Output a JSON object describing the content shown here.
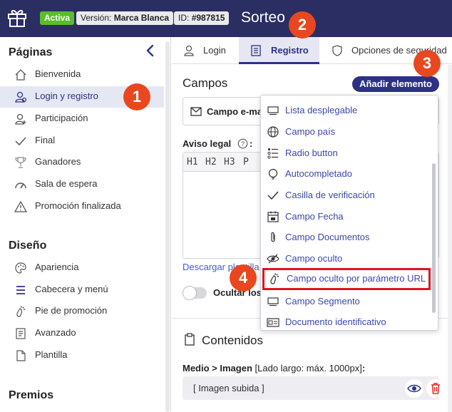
{
  "header": {
    "status_badge": "Activa",
    "version_label": "Versión:",
    "version_value": "Marca Blanca",
    "id_label": "ID:",
    "id_value": "#987815",
    "title": "Sorteo"
  },
  "markers": [
    "1",
    "2",
    "3",
    "4"
  ],
  "sidebar": {
    "sections": [
      {
        "title": "Páginas",
        "items": [
          {
            "label": "Bienvenida",
            "icon": "home-icon"
          },
          {
            "label": "Login y registro",
            "icon": "user-icon",
            "active": true
          },
          {
            "label": "Participación",
            "icon": "user-plus-icon"
          },
          {
            "label": "Final",
            "icon": "check-icon"
          },
          {
            "label": "Ganadores",
            "icon": "trophy-icon"
          },
          {
            "label": "Sala de espera",
            "icon": "speedometer-icon"
          },
          {
            "label": "Promoción finalizada",
            "icon": "warning-icon"
          }
        ]
      },
      {
        "title": "Diseño",
        "items": [
          {
            "label": "Apariencia",
            "icon": "palette-icon"
          },
          {
            "label": "Cabecera y menú",
            "icon": "menu-icon"
          },
          {
            "label": "Pie de promoción",
            "icon": "footprint-icon"
          },
          {
            "label": "Avanzado",
            "icon": "code-icon"
          },
          {
            "label": "Plantilla",
            "icon": "file-icon"
          }
        ]
      },
      {
        "title": "Premios",
        "items": []
      }
    ]
  },
  "tabs": [
    {
      "label": "Login",
      "icon": "user-icon"
    },
    {
      "label": "Registro",
      "icon": "form-icon",
      "active": true
    },
    {
      "label": "Opciones de seguridad",
      "icon": "shield-icon"
    }
  ],
  "main": {
    "campos_title": "Campos",
    "add_button": "Añadir elemento",
    "field_card_label": "Campo e-mail",
    "legal_label": "Aviso legal",
    "legal_colon": ":",
    "editor_toolbar": [
      "H1",
      "H2",
      "H3",
      "P"
    ],
    "download_link": "Descargar plantilla",
    "toggle_label": "Ocultar los",
    "contents_title": "Contenidos",
    "media_label": "Medio > Imagen",
    "media_hint": "[Lado largo: máx. 1000px]",
    "media_colon": ":",
    "image_value": "[ Imagen subida ]"
  },
  "dropdown": {
    "items": [
      {
        "label": "Lista desplegable",
        "icon": "list-icon"
      },
      {
        "label": "Campo país",
        "icon": "globe-icon"
      },
      {
        "label": "Radio button",
        "icon": "radio-list-icon"
      },
      {
        "label": "Autocompletado",
        "icon": "lightbulb-icon"
      },
      {
        "label": "Casilla de verificación",
        "icon": "check-icon"
      },
      {
        "label": "Campo Fecha",
        "icon": "calendar-icon"
      },
      {
        "label": "Campo Documentos",
        "icon": "paperclip-icon"
      },
      {
        "label": "Campo oculto",
        "icon": "eye-off-icon"
      },
      {
        "label": "Campo oculto por parámetro URL",
        "icon": "footprint-icon",
        "highlight": true
      },
      {
        "label": "Campo Segmento",
        "icon": "segment-icon"
      },
      {
        "label": "Documento identificativo",
        "icon": "id-card-icon"
      }
    ]
  },
  "colors": {
    "header_bg": "#2b2e63",
    "accent": "#2d3185",
    "active_badge": "#5bbd2b",
    "marker": "#e8471f",
    "highlight_border": "#e0141e",
    "link": "#3e5bd3"
  }
}
